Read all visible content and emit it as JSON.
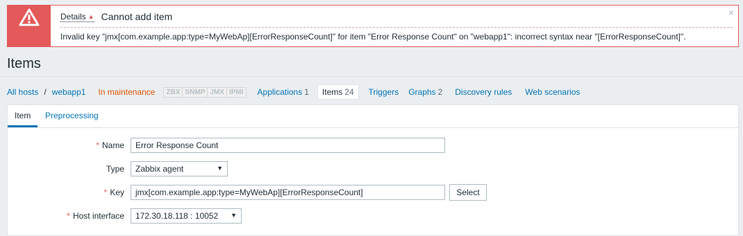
{
  "alert": {
    "details_label": "Details",
    "details_arrow": "▲",
    "title": "Cannot add item",
    "message": "Invalid key \"jmx[com.example.app:type=MyWebAp][ErrorResponseCount]\" for item \"Error Response Count\" on \"webapp1\": incorrect syntax near \"[ErrorResponseCount]\".",
    "close_glyph": "×"
  },
  "page": {
    "title": "Items"
  },
  "hostnav": {
    "all_hosts": "All hosts",
    "separator": "/",
    "host": "webapp1",
    "maintenance": "In maintenance",
    "availability": [
      "ZBX",
      "SNMP",
      "JMX",
      "IPMI"
    ],
    "links": [
      {
        "label": "Applications",
        "count": "1"
      },
      {
        "label": "Items",
        "count": "24"
      },
      {
        "label": "Triggers",
        "count": ""
      },
      {
        "label": "Graphs",
        "count": "2"
      },
      {
        "label": "Discovery rules",
        "count": ""
      },
      {
        "label": "Web scenarios",
        "count": ""
      }
    ]
  },
  "tabs": {
    "item": "Item",
    "preprocessing": "Preprocessing"
  },
  "form": {
    "required_mark": "*",
    "name_label": "Name",
    "name_value": "Error Response Count",
    "type_label": "Type",
    "type_value": "Zabbix agent",
    "key_label": "Key",
    "key_value": "jmx[com.example.app:type=MyWebAp][ErrorResponseCount]",
    "select_button": "Select",
    "host_interface_label": "Host interface",
    "host_interface_value": "172.30.18.118 : 10052",
    "dropdown_arrow": "▼"
  },
  "colors": {
    "error": "#e45959",
    "link": "#0275b8",
    "maintenance": "#e45300"
  }
}
